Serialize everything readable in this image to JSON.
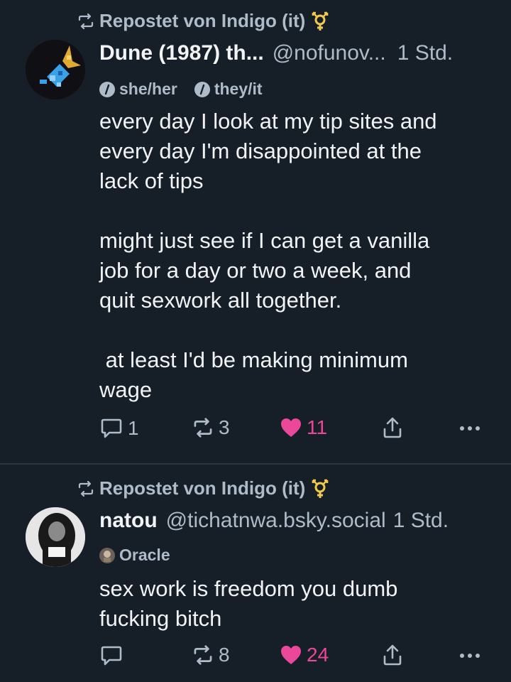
{
  "posts": [
    {
      "repost_text": "Repostet von Indigo (it)",
      "display_name": "Dune (1987) th...",
      "handle": "@nofunov...",
      "time": "1 Std.",
      "labels": [
        "she/her",
        "they/it"
      ],
      "text": "every day I look at my tip sites and\nevery day I'm disappointed at the\nlack of tips\n\nmight just see if I can get a vanilla\njob for a day or two a week, and\nquit sexwork all together.\n\n at least I'd be making minimum\nwage",
      "actions": {
        "replies": "1",
        "reposts": "3",
        "likes": "11"
      }
    },
    {
      "repost_text": "Repostet von Indigo (it)",
      "display_name": "natou",
      "handle": "@tichatnwa.bsky.social",
      "time": "1 Std.",
      "labels": [
        "Oracle"
      ],
      "text": "sex work is freedom you dumb\nfucking bitch",
      "actions": {
        "replies": "",
        "reposts": "8",
        "likes": "24"
      }
    }
  ],
  "colors": {
    "background": "#161e27",
    "text": "#f1f3f5",
    "muted": "#aebbc9",
    "like": "#ec4899",
    "trans_flag_icon": "#f2c94c",
    "divider": "#2a3644"
  },
  "icons": [
    "repost-icon",
    "transgender-symbol-icon",
    "label-dot-icon",
    "reply-icon",
    "like-heart-icon",
    "share-icon",
    "more-icon"
  ]
}
